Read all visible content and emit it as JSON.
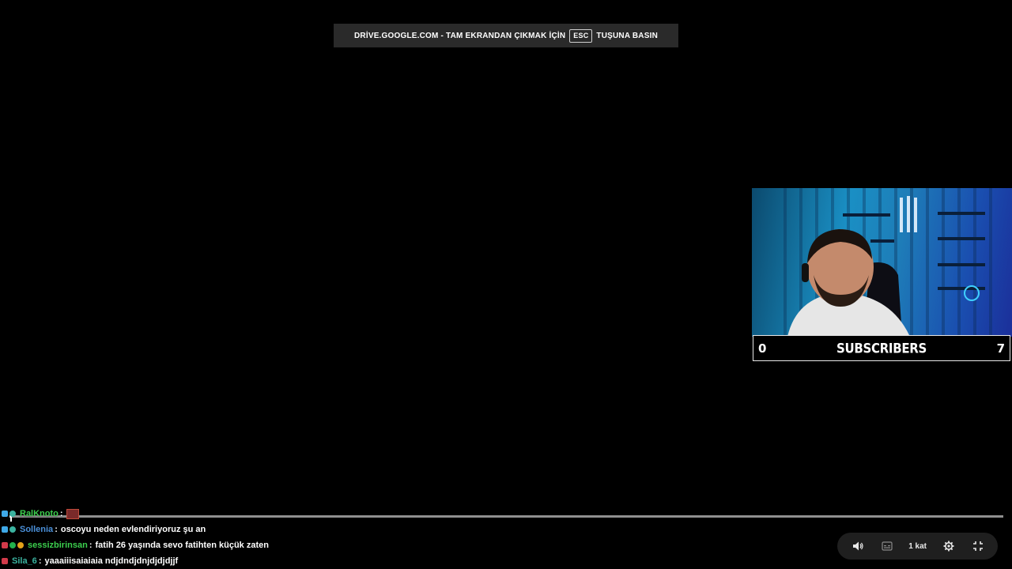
{
  "fullscreen_notice": {
    "text": "DRİVE.GOOGLE.COM - TAM EKRANDAN ÇIKMAK İÇİN",
    "key": "ESC",
    "suffix": "TUŞUNA BASIN"
  },
  "webcam": {
    "subscriber_bar": {
      "left_value": "0",
      "label": "SUBSCRIBERS",
      "right_value": "7"
    }
  },
  "chat": {
    "messages": [
      {
        "user": "RalKnoto",
        "separator": ":",
        "text": "",
        "user_color": "#3ccf4e",
        "badges": [
          "blue",
          "teal"
        ],
        "has_emote": true
      },
      {
        "user": "Sollenia",
        "separator": ":",
        "text": "oscoyu neden evlendiriyoruz şu an",
        "user_color": "#4a8fd8",
        "badges": [
          "blue",
          "teal"
        ],
        "has_emote": false
      },
      {
        "user": "sessizbirinsan",
        "separator": ":",
        "text": "fatih 26 yaşında sevo fatihten küçük zaten",
        "user_color": "#3ccf4e",
        "badges": [
          "red",
          "green",
          "gold"
        ],
        "has_emote": false
      },
      {
        "user": "Sila_6",
        "separator": ":",
        "text": "yaaaiiisaiaiaia ndjdndjdnjdjdjdjjf",
        "user_color": "#3bb3a0",
        "badges": [
          "red"
        ],
        "has_emote": false
      }
    ]
  },
  "player": {
    "progress_fraction": 0.002,
    "speed_label": "1 kat",
    "volume_icon": "volume-icon",
    "captions_icon": "captions-icon",
    "settings_icon": "settings-gear-icon",
    "fullscreen_icon": "fullscreen-exit-icon"
  },
  "colors": {
    "background": "#000000",
    "notice_bg": "#2a2a2a",
    "progress_track": "#8f8f8f",
    "progress_fill": "#e0e0e0",
    "controls_bg": "#1f1f1f"
  }
}
